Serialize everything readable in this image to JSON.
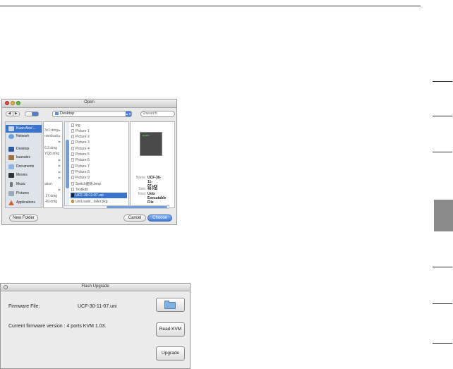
{
  "open_dialog": {
    "title": "Open",
    "location": "Desktop",
    "search_placeholder": "search",
    "nav": {
      "back": "◀",
      "forward": "▶"
    },
    "sidebar": [
      {
        "label": "Kuan Alex'...",
        "icon": "hard-drive-icon",
        "selected": true
      },
      {
        "label": "Network",
        "icon": "network-globe-icon"
      },
      {
        "label": "Desktop",
        "icon": "desktop-icon"
      },
      {
        "label": "kuanalex",
        "icon": "home-icon"
      },
      {
        "label": "Documents",
        "icon": "documents-folder-icon"
      },
      {
        "label": "Movies",
        "icon": "movies-folder-icon"
      },
      {
        "label": "Music",
        "icon": "music-note-icon"
      },
      {
        "label": "Pictures",
        "icon": "pictures-folder-icon"
      },
      {
        "label": "Applications",
        "icon": "applications-icon"
      }
    ],
    "column1": [
      "3c1.dmg",
      "ownload",
      "",
      "6.3.dmg",
      "YQ8.dmg",
      "",
      "",
      "",
      "",
      "ation",
      "",
      ".17.dmg",
      ".49.dmg"
    ],
    "column2_files": [
      {
        "name": "ing"
      },
      {
        "name": "Picture 1"
      },
      {
        "name": "Picture 2"
      },
      {
        "name": "Picture 3"
      },
      {
        "name": "Picture 4"
      },
      {
        "name": "Picture 5"
      },
      {
        "name": "Picture 6"
      },
      {
        "name": "Picture 7"
      },
      {
        "name": "Picture 8"
      },
      {
        "name": "Picture 9"
      },
      {
        "name": "Switch面板.bmp"
      },
      {
        "name": "TextEdit"
      },
      {
        "name": "UCF-30-11-07.uni",
        "selected": true
      },
      {
        "name": "UniLoade...taller.pkg"
      }
    ],
    "preview": {
      "thumb_text": "exec",
      "name_label": "Name",
      "name_value": "UCF-30-11-07.uni",
      "size_label": "Size",
      "size_value": "48 KB",
      "kind_label": "Kind",
      "kind_value": "Unix Executable File"
    },
    "buttons": {
      "new_folder": "New Folder",
      "cancel": "Cancel",
      "choose": "Choose"
    }
  },
  "flash_upgrade": {
    "title": "Flash Upgrade",
    "firmware_file_label": "Firmware File:",
    "firmware_file_value": "UCF-30-11-07.uni",
    "current_version": "Current firmware version : 4 ports KVM 1.03.",
    "buttons": {
      "browse_icon": "folder-icon",
      "read_kvm": "Read KVM",
      "upgrade": "Upgrade"
    }
  },
  "colors": {
    "selection": "#3a74cc",
    "side_tab": "#8a8a8a",
    "accent": "#4c7ed0"
  }
}
